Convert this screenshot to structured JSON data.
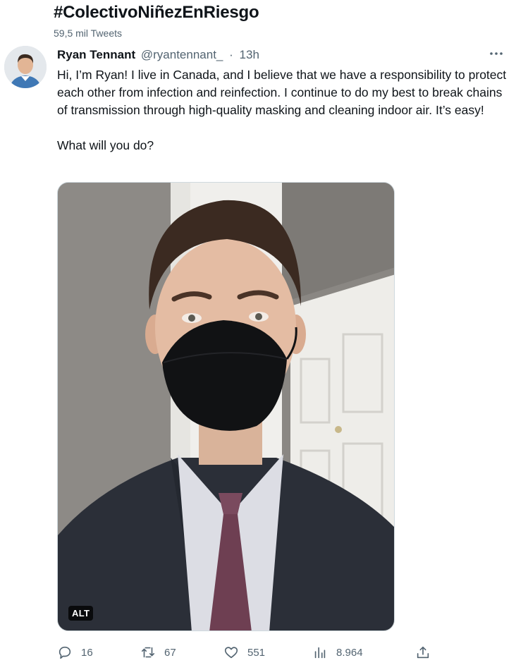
{
  "header": {
    "title": "#ColectivoNiñezEnRiesgo",
    "subtitle": "59,5 mil Tweets"
  },
  "tweet": {
    "author_name": "Ryan Tennant",
    "author_handle": "@ryantennant_",
    "separator": "·",
    "time": "13h",
    "text_paragraph_1": "Hi, I’m Ryan! I live in Canada, and I believe that we have a responsibility to protect each other from infection and reinfection. I continue to do my best to break chains of transmission through high-quality masking and cleaning indoor air. It’s easy!",
    "text_paragraph_2": "What will you do?",
    "media_alt_badge": "ALT"
  },
  "actions": {
    "replies": "16",
    "retweets": "67",
    "likes": "551",
    "views": "8.964"
  },
  "icons": {
    "more": "more-dots-icon",
    "reply": "reply-bubble-icon",
    "retweet": "retweet-arrows-icon",
    "like": "heart-icon",
    "views": "bar-chart-icon",
    "share": "share-upload-icon"
  },
  "colors": {
    "text_primary": "#0f1419",
    "text_secondary": "#536471",
    "border": "#cfd9de"
  }
}
